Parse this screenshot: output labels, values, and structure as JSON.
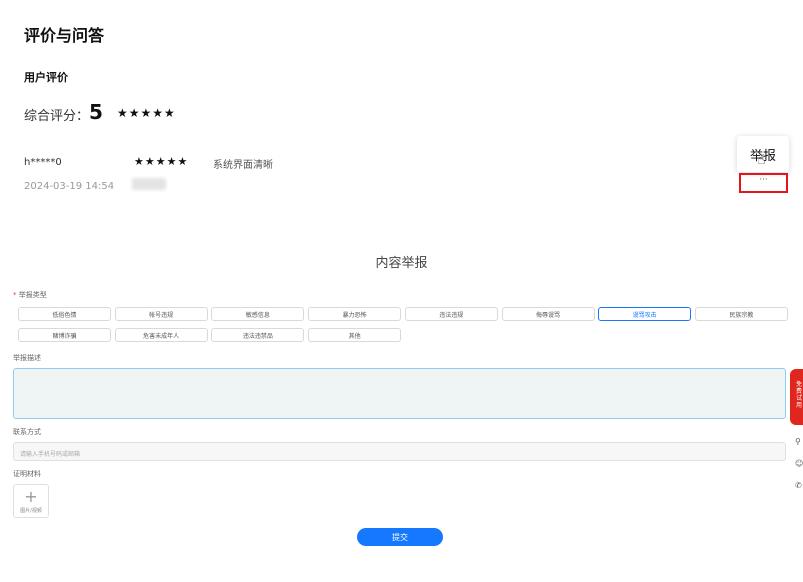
{
  "page": {
    "title": "评价与问答",
    "subtitle": "用户评价"
  },
  "overall": {
    "label": "综合评分：",
    "score": "5",
    "stars": "★★★★★"
  },
  "review": {
    "user": "h*****0",
    "stars": "★★★★★",
    "text": "系统界面清晰",
    "date": "2024-03-19 14:54"
  },
  "popover": {
    "report_label": "举报",
    "more_label": "···"
  },
  "report_form": {
    "title": "内容举报",
    "type_label": "举报类型",
    "required_mark": "*",
    "types": [
      {
        "label": "低俗色情",
        "selected": false
      },
      {
        "label": "帐号违规",
        "selected": false
      },
      {
        "label": "敏感信息",
        "selected": false
      },
      {
        "label": "暴力恐怖",
        "selected": false
      },
      {
        "label": "违法违规",
        "selected": false
      },
      {
        "label": "侮辱谩骂",
        "selected": false
      },
      {
        "label": "谩骂攻击",
        "selected": true
      },
      {
        "label": "民族宗教",
        "selected": false
      },
      {
        "label": "赌博诈骗",
        "selected": false
      },
      {
        "label": "危害未成年人",
        "selected": false
      },
      {
        "label": "违法违禁品",
        "selected": false
      },
      {
        "label": "其他",
        "selected": false
      }
    ],
    "desc_label": "举报描述",
    "contact_label": "联系方式",
    "contact_placeholder": "请输入手机号码或邮箱",
    "evidence_label": "证明材料",
    "upload_plus": "+",
    "upload_label": "图片/视频",
    "submit_label": "提交"
  },
  "side": {
    "tab_text": "免费试用",
    "icons": [
      "search-icon",
      "chat-icon",
      "phone-icon"
    ],
    "icon_glyphs": [
      "⚲",
      "☺",
      "✆"
    ]
  },
  "colors": {
    "accent": "#1677ff",
    "highlight": "#e0161c",
    "side_tab": "#e0261e"
  }
}
